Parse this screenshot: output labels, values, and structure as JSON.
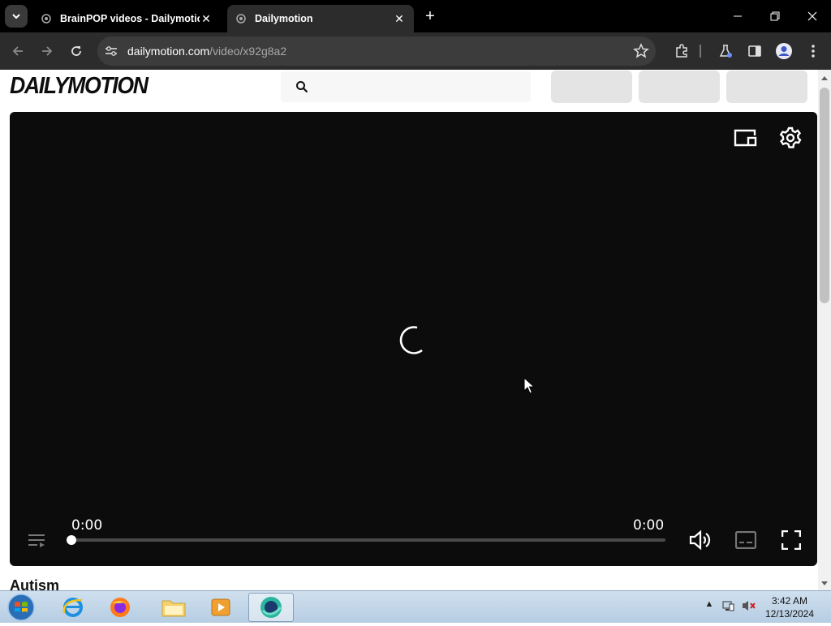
{
  "browser": {
    "tabs": [
      {
        "title": "BrainPOP videos - Dailymotion",
        "active": false
      },
      {
        "title": "Dailymotion",
        "active": true
      }
    ],
    "url_host": "dailymotion.com",
    "url_path": "/video/x92g8a2"
  },
  "page": {
    "logo": "DAILYMOTION",
    "section_heading": "Autism"
  },
  "player": {
    "current_time": "0:00",
    "duration": "0:00",
    "progress": 0
  },
  "taskbar": {
    "time": "3:42 AM",
    "date": "12/13/2024"
  },
  "icons": {
    "tab_search": "chevron-down-icon",
    "favicon": "dailymotion-favicon",
    "back": "arrow-left-icon",
    "forward": "arrow-right-icon",
    "reload": "reload-icon",
    "site_info": "tune-icon",
    "bookmark": "star-icon",
    "extensions": "puzzle-icon",
    "labs": "flask-icon",
    "side_panel": "side-panel-icon",
    "profile": "profile-icon",
    "menu": "kebab-menu-icon",
    "cast": "cast-icon",
    "settings": "gear-icon",
    "playlist": "playlist-icon",
    "volume": "volume-icon",
    "subtitles": "subtitles-icon",
    "fullscreen": "fullscreen-icon"
  },
  "colors": {
    "player_bg": "#0c0c0c",
    "chrome_dark": "#2c2c2c",
    "titlebar": "#000000"
  }
}
